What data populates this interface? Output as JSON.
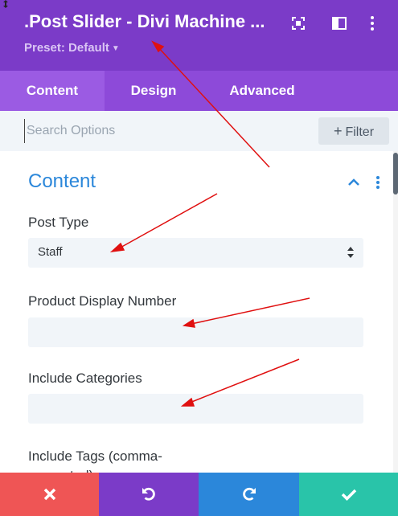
{
  "header": {
    "title": ".Post Slider - Divi Machine ...",
    "preset_label": "Preset: Default",
    "icons": [
      "expand-icon",
      "sidebar-toggle-icon",
      "more-vertical-icon"
    ]
  },
  "tabs": [
    {
      "label": "Content",
      "active": true
    },
    {
      "label": "Design",
      "active": false
    },
    {
      "label": "Advanced",
      "active": false
    }
  ],
  "search": {
    "placeholder": "Search Options",
    "value": "",
    "filter_label": "Filter"
  },
  "section": {
    "title": "Content",
    "icons": [
      "chevron-up-icon",
      "more-vertical-icon"
    ]
  },
  "fields": {
    "post_type": {
      "label": "Post Type",
      "value": "Staff"
    },
    "product_display_number": {
      "label": "Product Display Number",
      "value": ""
    },
    "include_categories": {
      "label": "Include Categories",
      "value": ""
    },
    "include_tags": {
      "label": "Include Tags (comma-separated)"
    }
  },
  "footer": {
    "buttons": [
      {
        "name": "discard",
        "icon": "close-icon",
        "color": "#ef5555"
      },
      {
        "name": "undo",
        "icon": "undo-icon",
        "color": "#7b3bc8"
      },
      {
        "name": "redo",
        "icon": "redo-icon",
        "color": "#2b87da"
      },
      {
        "name": "save",
        "icon": "check-icon",
        "color": "#29c4a9"
      }
    ]
  },
  "colors": {
    "header_purple": "#7b3bc8",
    "tab_purple": "#8d4ad9",
    "accent_blue": "#2b87da",
    "annotation_red": "#e01010"
  }
}
